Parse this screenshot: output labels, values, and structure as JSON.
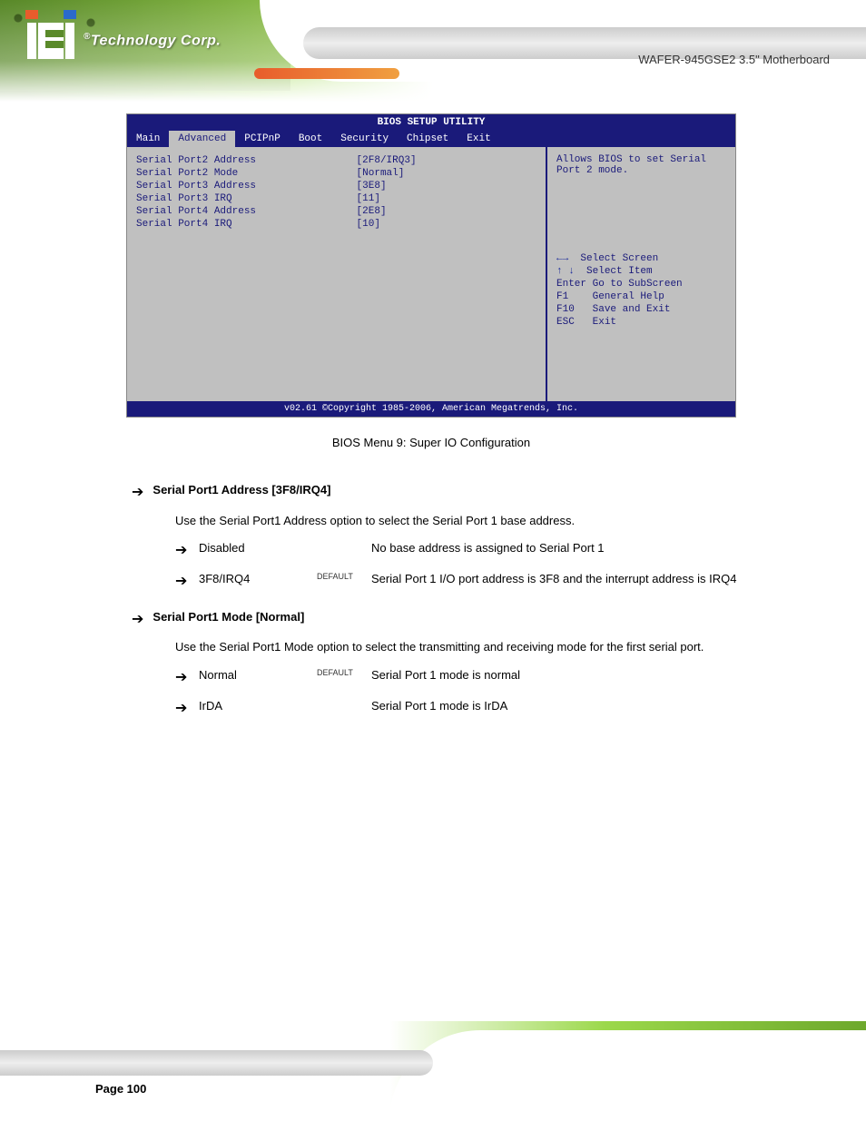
{
  "brand": {
    "logo_text": "Technology Corp.",
    "reg": "®"
  },
  "header_right": "WAFER-945GSE2 3.5\" Motherboard",
  "bios": {
    "title": "BIOS SETUP UTILITY",
    "tabs": [
      "Main",
      "Advanced",
      "PCIPnP",
      "Boot",
      "Security",
      "Chipset",
      "Exit"
    ],
    "active_tab": "Advanced",
    "rows": [
      {
        "label": "Serial Port2 Address",
        "value": "[2F8/IRQ3]"
      },
      {
        "label": "Serial Port2 Mode",
        "value": "[Normal]"
      },
      {
        "label": "Serial Port3 Address",
        "value": "[3E8]"
      },
      {
        "label": "Serial Port3 IRQ",
        "value": "[11]"
      },
      {
        "label": "Serial Port4 Address",
        "value": "[2E8]"
      },
      {
        "label": "Serial Port4 IRQ",
        "value": "[10]"
      }
    ],
    "help_text": "Allows BIOS to set Serial Port 2 mode.",
    "keys": [
      {
        "k": "←→",
        "d": "Select Screen",
        "arrow": true
      },
      {
        "k": "↑ ↓",
        "d": "Select Item",
        "arrow": true
      },
      {
        "k": "Enter",
        "d": "Go to SubScreen"
      },
      {
        "k": "F1",
        "d": "General Help"
      },
      {
        "k": "F10",
        "d": "Save and Exit"
      },
      {
        "k": "ESC",
        "d": "Exit"
      }
    ],
    "footer": "v02.61 ©Copyright 1985-2006, American Megatrends, Inc."
  },
  "caption": "BIOS Menu 9: Super IO Configuration",
  "options": [
    {
      "name": "Serial Port1 Address [3F8/IRQ4]",
      "desc": "Use the Serial Port1 Address option to select the Serial Port 1 base address.",
      "subs": [
        {
          "label": "Disabled",
          "def": "",
          "text": "No base address is assigned to Serial Port 1"
        },
        {
          "label": "3F8/IRQ4",
          "def": "DEFAULT",
          "text": "Serial Port 1 I/O port address is 3F8 and the interrupt address is IRQ4"
        }
      ]
    },
    {
      "name": "Serial Port1 Mode [Normal]",
      "desc": "Use the Serial Port1 Mode option to select the transmitting and receiving mode for the first serial port.",
      "subs": [
        {
          "label": "Normal",
          "def": "DEFAULT",
          "text": "Serial Port 1 mode is normal"
        },
        {
          "label": "IrDA",
          "def": "",
          "text": "Serial Port 1 mode is IrDA"
        }
      ]
    }
  ],
  "page": "Page 100"
}
